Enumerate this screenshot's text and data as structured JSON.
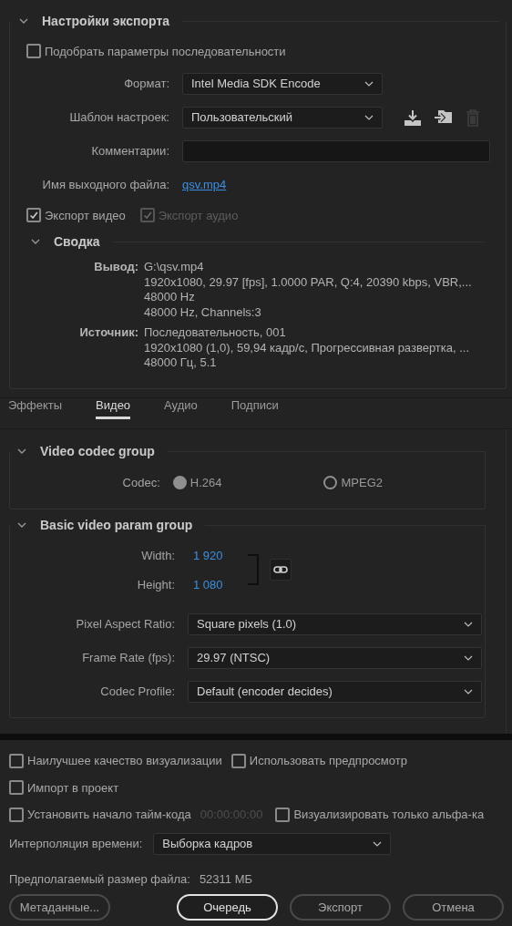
{
  "export_settings": {
    "title": "Настройки экспорта",
    "expanded": true,
    "match_sequence": {
      "label": "Подобрать параметры последовательности",
      "checked": false
    },
    "fields": [
      {
        "kind": "select",
        "label": "Формат:",
        "value": "Intel Media SDK Encode"
      },
      {
        "kind": "preset",
        "label": "Шаблон настроек:",
        "value": "Пользовательский"
      },
      {
        "kind": "input",
        "label": "Комментарии:"
      },
      {
        "kind": "link",
        "label": "Имя выходного файла:",
        "value": "qsv.mp4"
      }
    ],
    "export_checks": [
      {
        "label": "Экспорт видео",
        "checked": true,
        "disabled": false
      },
      {
        "label": "Экспорт аудио",
        "checked": true,
        "disabled": true
      }
    ],
    "summary": {
      "title": "Сводка",
      "expanded": true,
      "entries": [
        {
          "label": "Вывод:",
          "lines": [
            "G:\\qsv.mp4",
            "1920x1080, 29.97 [fps], 1.0000 PAR, Q:4, 20390 kbps, VBR,...",
            "48000 Hz",
            "48000 Hz, Channels:3"
          ]
        },
        {
          "label": "Источник:",
          "lines": [
            "Последовательность, 001",
            "1920x1080 (1,0), 59,94 кадр/с, Прогрессивная развертка, ...",
            "48000 Гц, 5.1"
          ]
        }
      ]
    }
  },
  "tabs": [
    {
      "label": "Эффекты",
      "selected": false
    },
    {
      "label": "Видео",
      "selected": true
    },
    {
      "label": "Аудио",
      "selected": false
    },
    {
      "label": "Подписи",
      "selected": false
    }
  ],
  "groups": [
    {
      "title": "Video codec group",
      "expanded": true,
      "rows": [
        {
          "kind": "radio",
          "label": "Codec:",
          "options": [
            {
              "label": "H.264",
              "selected": true
            },
            {
              "label": "MPEG2",
              "selected": false
            }
          ]
        }
      ]
    },
    {
      "title": "Basic video param group",
      "expanded": true,
      "rows": [
        {
          "kind": "dimensions",
          "linked": true,
          "fields": [
            {
              "label": "Width:",
              "value": "1 920"
            },
            {
              "label": "Height:",
              "value": "1 080"
            }
          ]
        },
        {
          "kind": "select",
          "label": "Pixel Aspect Ratio:",
          "value": "Square pixels (1.0)"
        },
        {
          "kind": "select",
          "label": "Frame Rate (fps):",
          "value": "29.97 (NTSC)"
        },
        {
          "kind": "select",
          "label": "Codec Profile:",
          "value": "Default (encoder decides)"
        }
      ]
    }
  ],
  "render_options": [
    [
      {
        "kind": "check",
        "label": "Наилучшее качество визуализации",
        "checked": false
      },
      {
        "kind": "check",
        "label": "Использовать предпросмотр",
        "checked": false
      }
    ],
    [
      {
        "kind": "check",
        "label": "Импорт в проект",
        "checked": false
      }
    ],
    [
      {
        "kind": "check",
        "label": "Установить начало тайм-кода",
        "checked": false
      },
      {
        "kind": "timecode",
        "value": "00:00:00:00"
      },
      {
        "kind": "check",
        "label": "Визуализировать только альфа-ка",
        "checked": false
      }
    ]
  ],
  "time_interpolation": {
    "label": "Интерполяция времени:",
    "value": "Выборка кадров"
  },
  "file_size": {
    "label": "Предполагаемый размер файла:",
    "value": "52311 МБ"
  },
  "buttons": [
    {
      "label": "Метаданные...",
      "kind": "side"
    },
    {
      "label": "Очередь",
      "kind": "default"
    },
    {
      "label": "Экспорт",
      "kind": "normal"
    },
    {
      "label": "Отмена",
      "kind": "normal"
    }
  ]
}
